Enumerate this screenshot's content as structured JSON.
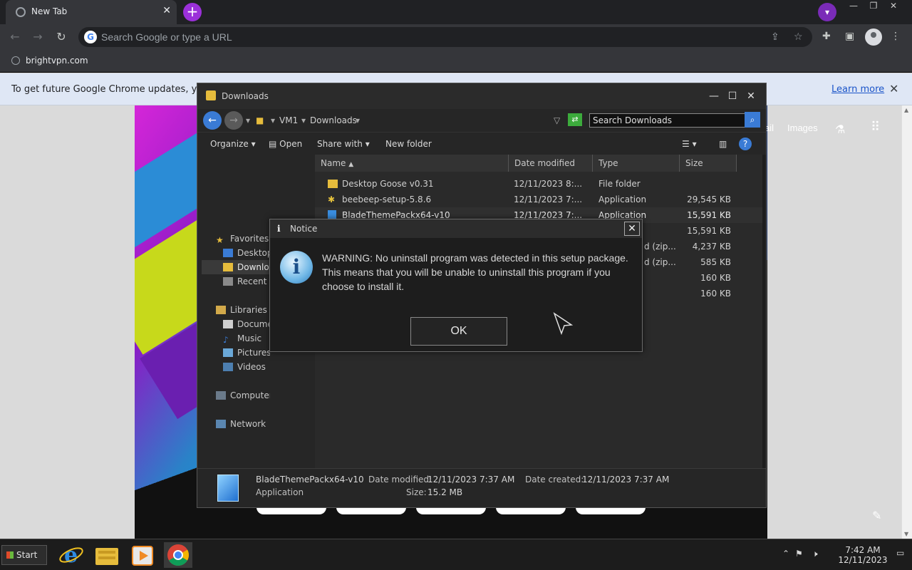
{
  "browser": {
    "tab_title": "New Tab",
    "tab_close": "✕",
    "new_tab": "+",
    "omnibox_placeholder": "Search Google or type a URL",
    "bookmark": "brightvpn.com",
    "infobar_message": "To get future Google Chrome updates, you'll",
    "infobar_link": "Learn more",
    "infobar_close": "✕",
    "ntp_links": [
      "ail",
      "Images"
    ]
  },
  "explorer": {
    "title": "Downloads",
    "breadcrumb": [
      "VM1",
      "Downloads"
    ],
    "search_placeholder": "Search Downloads",
    "commands": [
      "Organize",
      "Open",
      "Share with",
      "New folder"
    ],
    "nav": {
      "favorites_header": "Favorites",
      "favorites": [
        "Desktop",
        "Downloads",
        "Recent Places"
      ],
      "libraries_header": "Libraries",
      "libraries": [
        "Documents",
        "Music",
        "Pictures",
        "Videos"
      ],
      "computer": "Computer",
      "network": "Network"
    },
    "columns": [
      "Name",
      "Date modified",
      "Type",
      "Size"
    ],
    "files": [
      {
        "name": "Desktop Goose v0.31",
        "date": "12/11/2023 8:...",
        "type": "File folder",
        "size": ""
      },
      {
        "name": "beebeep-setup-5.8.6",
        "date": "12/11/2023 7:...",
        "type": "Application",
        "size": "29,545 KB"
      },
      {
        "name": "BladeThemePackx64-v10",
        "date": "12/11/2023 7:...",
        "type": "Application",
        "size": "15,591 KB"
      },
      {
        "name": "",
        "date": "",
        "type": "",
        "size": "15,591 KB"
      },
      {
        "name": "",
        "date": "",
        "type": "d (zip...",
        "size": "4,237 KB"
      },
      {
        "name": "",
        "date": "",
        "type": "d (zip...",
        "size": "585 KB"
      },
      {
        "name": "",
        "date": "",
        "type": "",
        "size": "160 KB"
      },
      {
        "name": "",
        "date": "",
        "type": "",
        "size": "160 KB"
      }
    ],
    "details": {
      "name": "BladeThemePackx64-v10",
      "type": "Application",
      "date_modified_label": "Date modified:",
      "date_modified": "12/11/2023 7:37 AM",
      "date_created_label": "Date created:",
      "date_created": "12/11/2023 7:37 AM",
      "size_label": "Size:",
      "size": "15.2 MB"
    }
  },
  "notice": {
    "title": "Notice",
    "message": "WARNING: No uninstall program was detected in this setup package.  This means that you will be unable to uninstall this program if you choose to install it.",
    "ok_label": "OK",
    "close": "✕"
  },
  "taskbar": {
    "start_label": "Start",
    "time": "7:42 AM",
    "date": "12/11/2023"
  }
}
